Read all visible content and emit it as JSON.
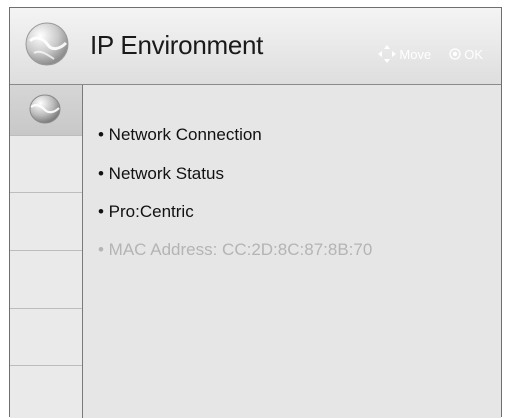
{
  "header": {
    "title": "IP Environment",
    "hints": {
      "move_label": "Move",
      "ok_label": "OK"
    }
  },
  "sidebar": {
    "cells": [
      {
        "icon": "globe-icon",
        "active": true
      },
      {
        "icon": "",
        "active": false
      },
      {
        "icon": "",
        "active": false
      },
      {
        "icon": "",
        "active": false
      },
      {
        "icon": "",
        "active": false
      },
      {
        "icon": "",
        "active": false
      }
    ]
  },
  "menu": {
    "items": [
      {
        "label": "• Network Connection",
        "enabled": true
      },
      {
        "label": "• Network Status",
        "enabled": true
      },
      {
        "label": "• Pro:Centric",
        "enabled": true
      },
      {
        "label": "• MAC Address: CC:2D:8C:87:8B:70",
        "enabled": false
      }
    ]
  },
  "colors": {
    "frame_border": "#6f6f6f",
    "panel_bg": "#e6e6e6",
    "text": "#111111",
    "disabled_text": "#b4b4b4"
  }
}
